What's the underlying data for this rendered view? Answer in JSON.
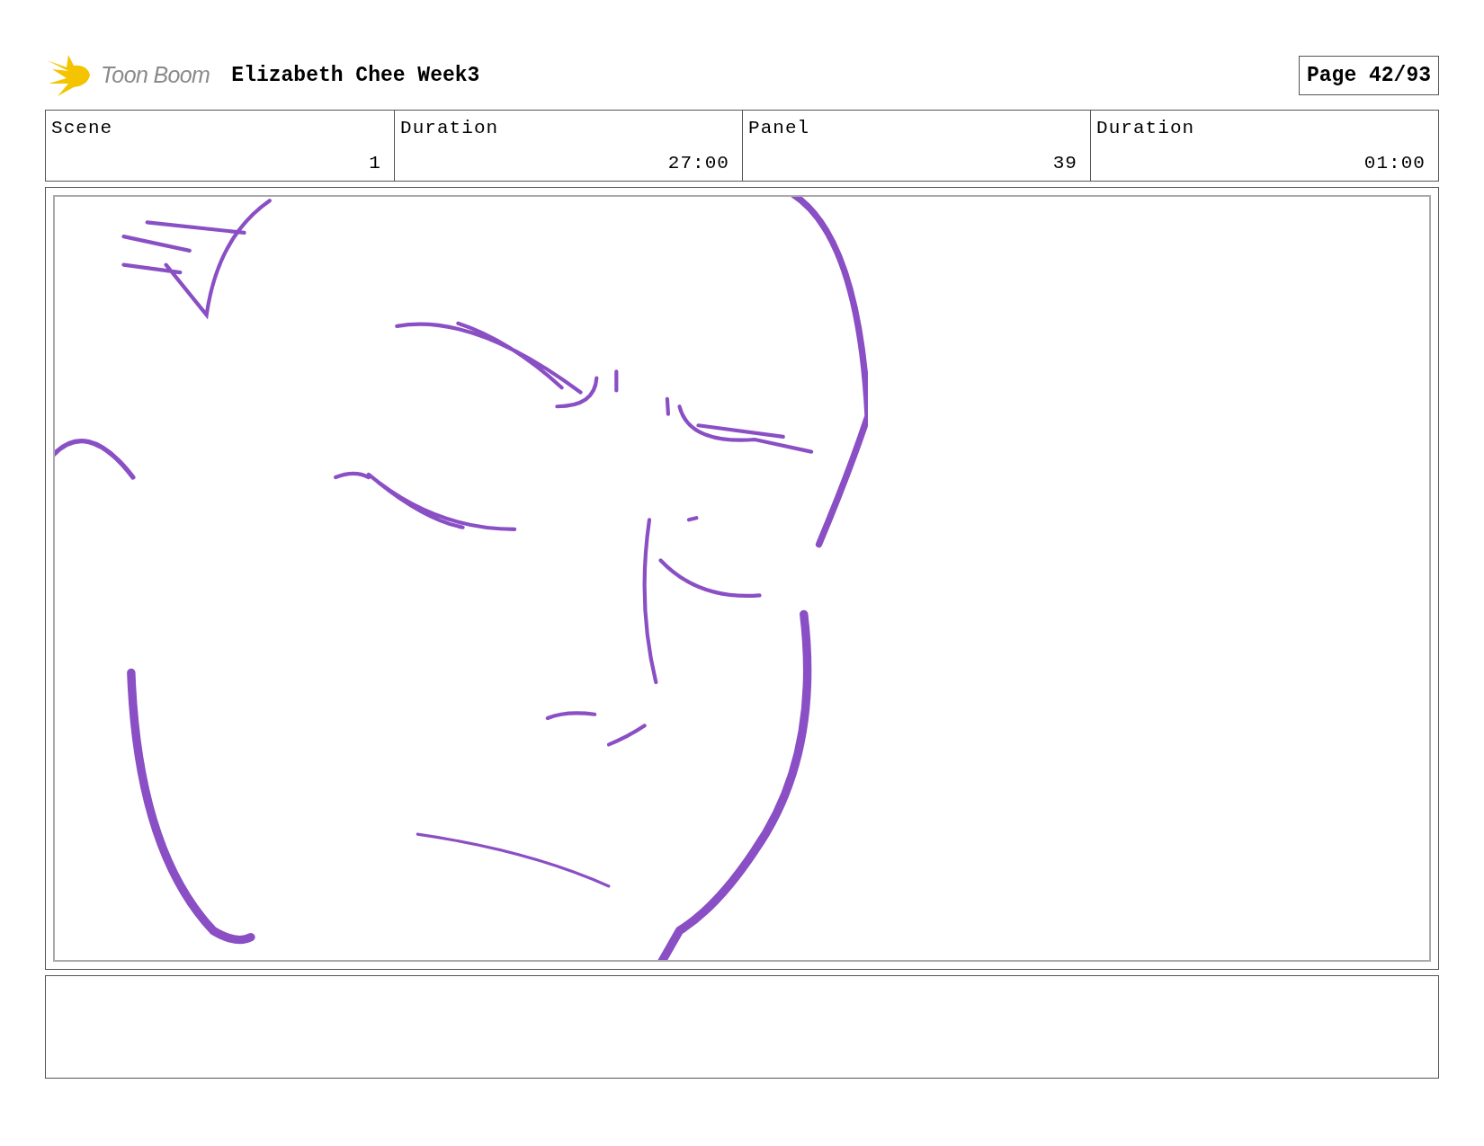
{
  "header": {
    "logo_text": "Toon Boom",
    "title": "Elizabeth Chee Week3",
    "page": "Page 42/93"
  },
  "fields": [
    {
      "label": "Scene",
      "value": "1"
    },
    {
      "label": "Duration",
      "value": "27:00"
    },
    {
      "label": "Panel",
      "value": "39"
    },
    {
      "label": "Duration",
      "value": "01:00"
    }
  ]
}
